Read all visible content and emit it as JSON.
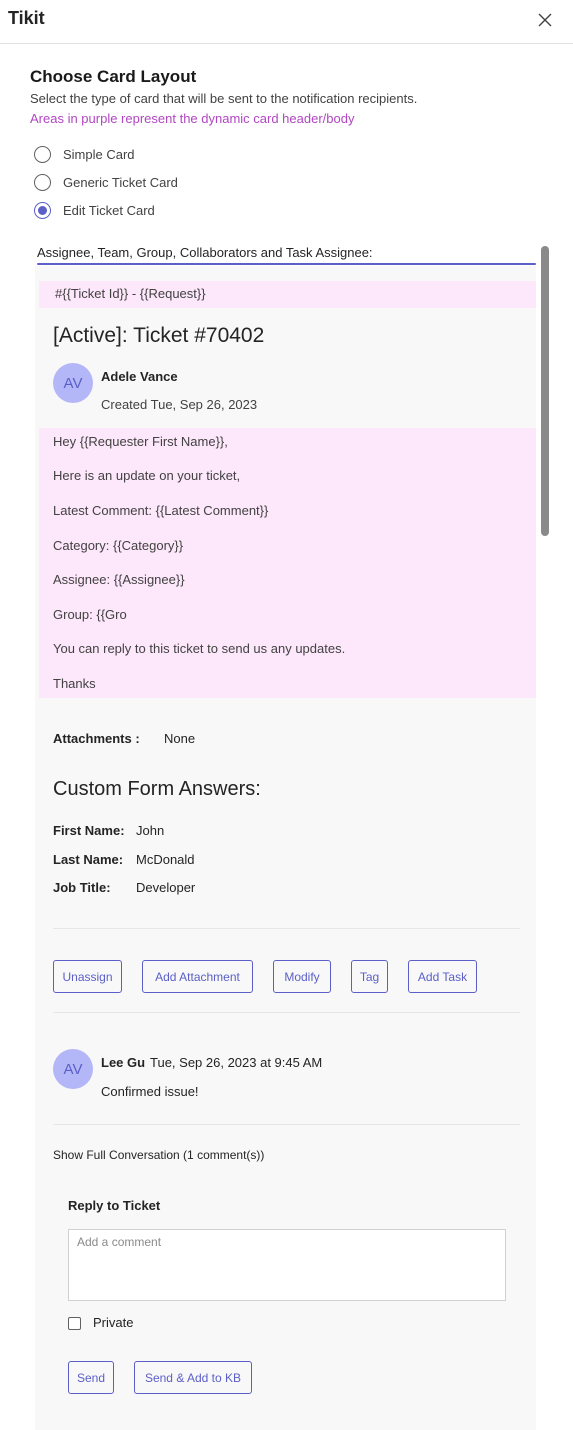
{
  "app": {
    "title": "Tikit"
  },
  "layout_section": {
    "heading": "Choose Card Layout",
    "description": "Select the type of card that will be sent to the notification recipients.",
    "hint": "Areas in purple represent the dynamic card header/body",
    "options": [
      {
        "label": "Simple Card",
        "selected": false
      },
      {
        "label": "Generic Ticket Card",
        "selected": false
      },
      {
        "label": "Edit Ticket Card",
        "selected": true
      }
    ]
  },
  "recipients_label": "Assignee, Team, Group, Collaborators and Task Assignee:",
  "card": {
    "header": "#{{Ticket Id}} - {{Request}}",
    "title": "[Active]: Ticket #70402",
    "requester": {
      "initials": "AV",
      "name": "Adele Vance",
      "created": "Created Tue, Sep 26, 2023"
    },
    "body_lines": [
      "Hey {{Requester First Name}},",
      "Here is an update on your ticket,",
      "Latest Comment: {{Latest Comment}}",
      "Category: {{Category}}",
      "Assignee: {{Assignee}}",
      "Group: {{Gro",
      "You can reply to this ticket to send us any updates.",
      "Thanks"
    ],
    "attachments": {
      "label": "Attachments :",
      "value": "None"
    },
    "custom_form": {
      "title": "Custom Form Answers:",
      "fields": [
        {
          "label": "First Name:",
          "value": "John"
        },
        {
          "label": "Last Name:",
          "value": "McDonald"
        },
        {
          "label": "Job Title:",
          "value": "Developer"
        }
      ]
    },
    "actions": {
      "unassign": "Unassign",
      "add_attachment": "Add Attachment",
      "modify": "Modify",
      "tag": "Tag",
      "add_task": "Add Task"
    },
    "comment": {
      "initials": "AV",
      "author": "Lee Gu",
      "timestamp": "Tue, Sep 26, 2023 at 9:45 AM",
      "text": "Confirmed issue!"
    },
    "show_full": "Show Full Conversation (1 comment(s))",
    "reply": {
      "title": "Reply to Ticket",
      "placeholder": "Add a comment",
      "private_label": "Private",
      "send": "Send",
      "send_kb": "Send & Add to KB"
    }
  },
  "colors": {
    "accent": "#5b5fc7",
    "hint_purple": "#b146c2",
    "dynamic_area": "#fde7fb",
    "avatar_bg": "#b4b7f7"
  }
}
